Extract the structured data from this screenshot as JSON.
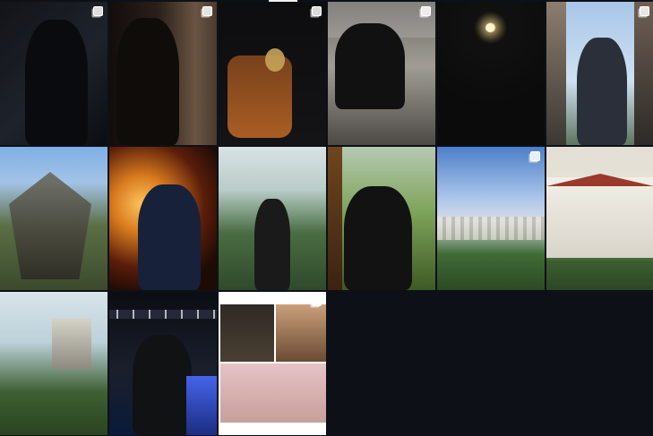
{
  "profile_grid": {
    "posts": [
      {
        "id_label": "post-1",
        "multi": true
      },
      {
        "id_label": "post-2",
        "multi": true
      },
      {
        "id_label": "post-3",
        "multi": true
      },
      {
        "id_label": "post-4",
        "multi": true
      },
      {
        "id_label": "post-5",
        "multi": false
      },
      {
        "id_label": "post-6",
        "multi": true
      },
      {
        "id_label": "post-7",
        "multi": false
      },
      {
        "id_label": "post-8",
        "multi": false
      },
      {
        "id_label": "post-9",
        "multi": false
      },
      {
        "id_label": "post-10",
        "multi": false
      },
      {
        "id_label": "post-11",
        "multi": true
      },
      {
        "id_label": "post-12",
        "multi": false
      },
      {
        "id_label": "post-13",
        "multi": false
      },
      {
        "id_label": "post-14",
        "multi": false
      },
      {
        "id_label": "post-15",
        "multi": true
      }
    ]
  },
  "icons": {
    "multi_post": "carousel-icon"
  },
  "colors": {
    "page_bg": "#0d1117",
    "tab_indicator": "#f2f2f2"
  }
}
